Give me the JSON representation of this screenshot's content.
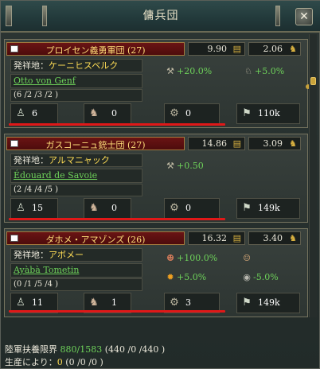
{
  "window": {
    "title": "傭兵団"
  },
  "colors": {
    "accent_red": "#e01818",
    "bonus_green": "#6ed25a",
    "gold": "#ffdd55"
  },
  "regiments": [
    {
      "name": "プロイセン義勇軍団",
      "count": "(27)",
      "money_a": "9.90",
      "money_b": "2.06",
      "origin_label": "発祥地：",
      "origin_value": "ケーニヒスベルク",
      "commander": "Otto von Genf",
      "skills": "(6 /2 /3 /2 )",
      "mods": [
        {
          "icon": "cannon-icon",
          "text": "+20.0%"
        },
        {
          "icon": "horse-icon",
          "text": "+5.0%"
        }
      ],
      "units": {
        "infantry": "6",
        "cavalry": "0",
        "artillery": "0",
        "manpower": "110k"
      }
    },
    {
      "name": "ガスコーニュ銃士団",
      "count": "(27)",
      "money_a": "14.86",
      "money_b": "3.09",
      "origin_label": "発祥地：",
      "origin_value": "アルマニャック",
      "commander": "Édouard de Savoie",
      "skills": "(2 /4 /4 /5 )",
      "mods": [
        {
          "icon": "cannon-icon",
          "text": "+0.50"
        }
      ],
      "units": {
        "infantry": "15",
        "cavalry": "0",
        "artillery": "0",
        "manpower": "149k"
      }
    },
    {
      "name": "ダホメ・アマゾンズ",
      "count": "(26)",
      "money_a": "16.32",
      "money_b": "3.40",
      "origin_label": "発祥地：",
      "origin_value": "アボメー",
      "commander": "Ayàbà Tometin",
      "skills": "(0 /1 /5 /4 )",
      "mods": [
        {
          "icon": "bust-icon",
          "text": "+100.0%"
        },
        {
          "icon": "fire-icon",
          "text": "+5.0%"
        },
        {
          "icon": "shield-icon",
          "text": "-5.0%"
        }
      ],
      "units": {
        "infantry": "11",
        "cavalry": "1",
        "artillery": "3",
        "manpower": "149k"
      }
    }
  ],
  "footer": {
    "limit_label": "陸軍扶養限界",
    "limit_value": "880/1583",
    "limit_breakdown": "(440  /0  /440  )",
    "production_label": "生産により：",
    "production_value": "0",
    "production_breakdown": "(0  /0  /0  )"
  }
}
